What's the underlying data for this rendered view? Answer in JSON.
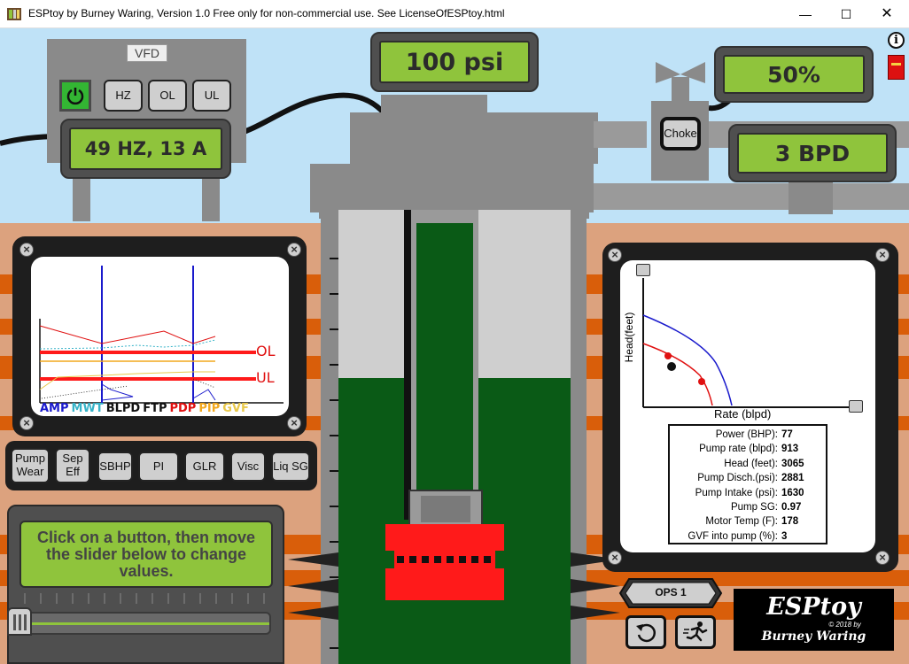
{
  "window": {
    "title": "ESPtoy by Burney Waring, Version 1.0  Free only for non-commercial use. See LicenseOfESPtoy.html"
  },
  "vfd": {
    "label": "VFD",
    "buttons": [
      "HZ",
      "OL",
      "UL"
    ],
    "display": "49 HZ,  13 A"
  },
  "pressure_display": "100 psi",
  "choke": {
    "label": "Choke",
    "percent_display": "50%",
    "rate_display": "3 BPD"
  },
  "trend": {
    "legend": [
      {
        "label": "AMP",
        "color": "#1a1acc"
      },
      {
        "label": "MWT",
        "color": "#37b3c8"
      },
      {
        "label": "BLPD",
        "color": "#111111"
      },
      {
        "label": "FTP",
        "color": "#111111"
      },
      {
        "label": "PDP",
        "color": "#e01010"
      },
      {
        "label": "PIP",
        "color": "#f2a81e"
      },
      {
        "label": "GVF",
        "color": "#e8c84a"
      }
    ],
    "ol_label": "OL",
    "ul_label": "UL"
  },
  "param_buttons": [
    {
      "id": "pump-wear",
      "label": "Pump Wear"
    },
    {
      "id": "sep-eff",
      "label": "Sep Eff"
    },
    {
      "id": "sbhp",
      "label": "SBHP"
    },
    {
      "id": "pi",
      "label": "PI"
    },
    {
      "id": "glr",
      "label": "GLR"
    },
    {
      "id": "visc",
      "label": "Visc"
    },
    {
      "id": "liq-sg",
      "label": "Liq SG"
    }
  ],
  "message": "Click on a button, then move the slider below to change values.",
  "slider": {
    "value": 0
  },
  "pump_curve": {
    "ylabel": "Head(feet)",
    "xlabel": "Rate (blpd)"
  },
  "metrics": [
    {
      "label": "Power (BHP):",
      "value": "77"
    },
    {
      "label": "Pump rate (blpd):",
      "value": "913"
    },
    {
      "label": "Head (feet):",
      "value": "3065"
    },
    {
      "label": "Pump Disch.(psi):",
      "value": "2881"
    },
    {
      "label": "Pump Intake (psi):",
      "value": "1630"
    },
    {
      "label": "Pump SG:",
      "value": "0.97"
    },
    {
      "label": "Motor Temp (F):",
      "value": "178"
    },
    {
      "label": "GVF into pump (%):",
      "value": "3"
    }
  ],
  "ops": {
    "label": "OPS 1"
  },
  "brand": {
    "name": "ESPtoy",
    "copyright": "© 2018 by",
    "author": "Burney Waring"
  },
  "colors": {
    "lcd_green": "#8fc43c",
    "fluid_green": "#0a5a16",
    "pump_red": "#ff1a1a",
    "sky": "#bfe2f7",
    "earth": "#dca27e",
    "earth_band": "#d95e0a"
  }
}
